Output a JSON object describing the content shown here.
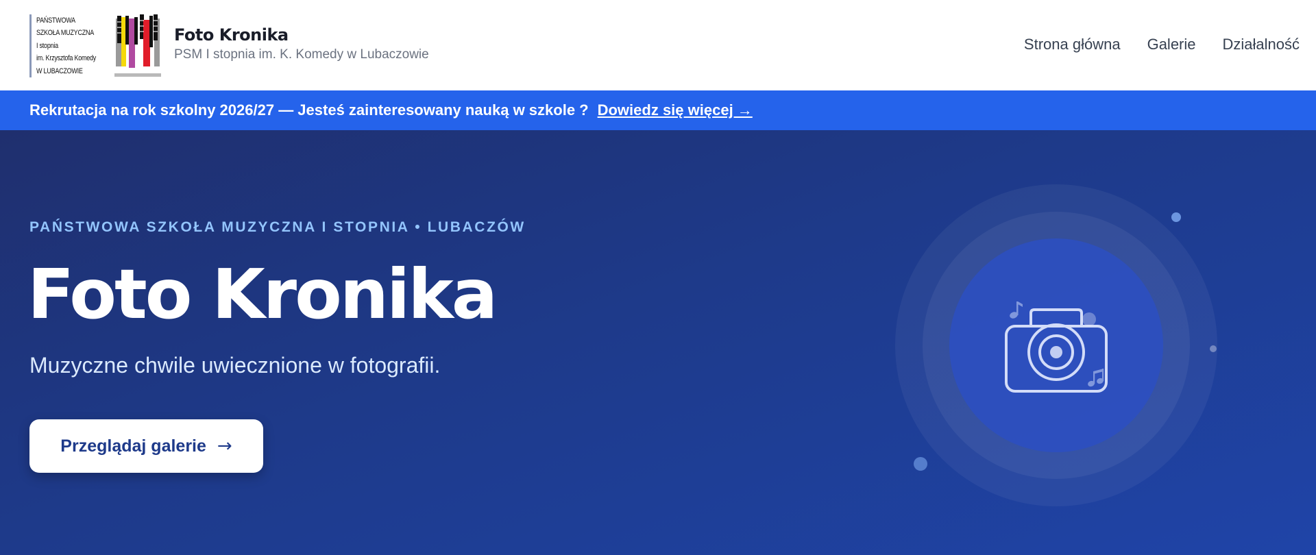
{
  "header": {
    "logo_lines": [
      "PAŃSTWOWA",
      "SZKOŁA MUZYCZNA",
      "I stopnia",
      "im. Krzysztofa Komedy",
      "W LUBACZOWIE"
    ],
    "brand_title": "Foto Kronika",
    "brand_subtitle": "PSM I stopnia im. K. Komedy w Lubaczowie",
    "nav": [
      {
        "label": "Strona główna"
      },
      {
        "label": "Galerie"
      },
      {
        "label": "Działalność"
      }
    ]
  },
  "announcement": {
    "text": "Rekrutacja na rok szkolny 2026/27 — Jesteś zainteresowany nauką w szkole ?",
    "link_label": "Dowiedz się więcej →"
  },
  "hero": {
    "eyebrow": "PAŃSTWOWA SZKOŁA MUZYCZNA I STOPNIA • LUBACZÓW",
    "title": "Foto Kronika",
    "subtitle": "Muzyczne chwile uwiecznione w fotografii.",
    "cta_label": "Przeglądaj galerie",
    "cta_arrow": "→"
  },
  "colors": {
    "accent": "#2563eb",
    "hero_bg": "#1e3a8a",
    "eyebrow": "#93c5fd",
    "logo_bars": [
      "#111111",
      "#f5d90a",
      "#b04aa0",
      "#e11d2a",
      "#111111"
    ]
  },
  "icons": {
    "hero_illustration": "camera-icon",
    "decor": "music-note-icon"
  }
}
